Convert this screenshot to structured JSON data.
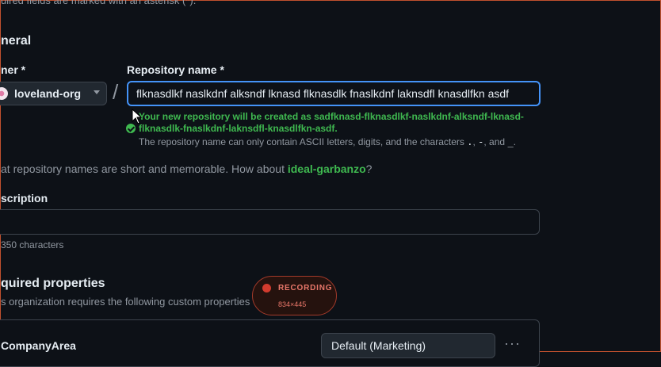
{
  "top_note": "uired fields are marked with an asterisk (*).",
  "general": {
    "heading": "neral"
  },
  "owner": {
    "label": "ner *",
    "selected": "loveland-org"
  },
  "separator": "/",
  "repo": {
    "label": "Repository name *",
    "value": "flknasdlkf naslkdnf alksndf lknasd flknasdlk fnaslkdnf laknsdfl knasdlfkn asdf",
    "success_message": "Your new repository will be created as sadfknasd-flknasdlkf-naslkdnf-alksndf-lknasd-flknasdlk-fnaslkdnf-laknsdfl-knasdlfkn-asdf.",
    "hint_prefix": "The repository name can only contain ASCII letters, digits, and the characters",
    "hint_chars_1": ".",
    "hint_sep_1": ",",
    "hint_chars_2": "-",
    "hint_sep_2": ", and",
    "hint_chars_3": "_",
    "hint_suffix": "."
  },
  "suggestion": {
    "prefix": "at repository names are short and memorable. How about",
    "name": "ideal-garbanzo",
    "suffix": "?"
  },
  "description": {
    "label": "scription",
    "value": "",
    "count": "350 characters"
  },
  "properties": {
    "heading": "quired properties",
    "subtitle": "s organization requires the following custom properties",
    "items": [
      {
        "name": "CompanyArea",
        "value": "Default (Marketing)"
      }
    ],
    "more": "···"
  },
  "recording": {
    "label": "RECORDING",
    "size": "834×445",
    "accent": "#d23b2e"
  },
  "colors": {
    "background": "#0d1117",
    "focus": "#4493f8",
    "success": "#3fb950",
    "muted": "#9198a1"
  }
}
